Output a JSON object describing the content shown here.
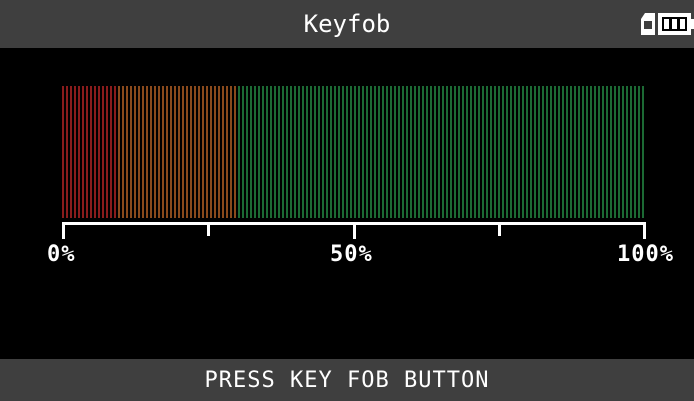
{
  "title": "Keyfob",
  "status_icons": [
    "sd-card-icon",
    "battery-icon"
  ],
  "meter": {
    "scale_labels": {
      "min": "0%",
      "mid": "50%",
      "max": "100%"
    },
    "colors": {
      "low": "#8a1c1c",
      "mid": "#8a4a1c",
      "high": "#1c6a34",
      "background": "#000000"
    }
  },
  "footer": "PRESS KEY FOB BUTTON"
}
